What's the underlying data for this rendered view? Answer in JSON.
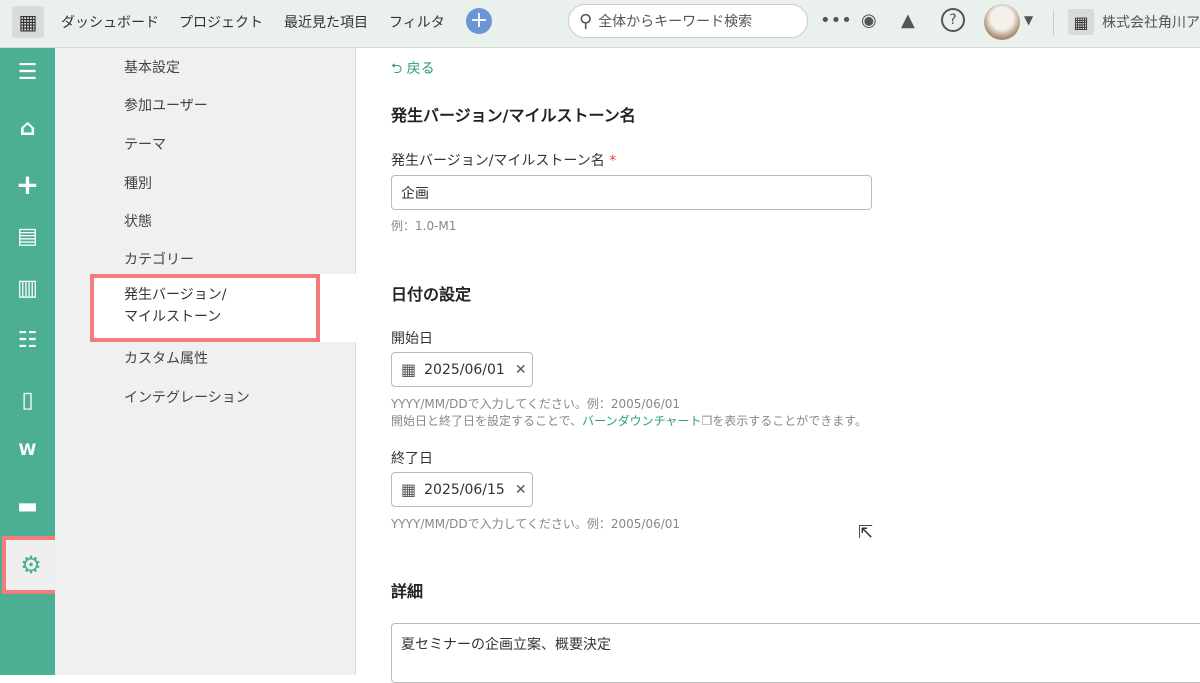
{
  "header": {
    "nav": [
      "ダッシュボード",
      "プロジェクト",
      "最近見た項目",
      "フィルタ"
    ],
    "search_placeholder": "全体からキーワード検索",
    "company": "株式会社角川ア"
  },
  "sidebar": {
    "items": [
      "基本設定",
      "参加ユーザー",
      "テーマ",
      "種別",
      "状態",
      "カテゴリー",
      "発生バージョン/",
      "マイルストーン",
      "カスタム属性",
      "インテグレーション"
    ]
  },
  "main": {
    "back": "戻る",
    "section1": "発生バージョン/マイルストーン名",
    "name_label": "発生バージョン/マイルストーン名",
    "required": "*",
    "name_value": "企画",
    "name_hint": "例：1.0-M1",
    "section2": "日付の設定",
    "start_label": "開始日",
    "start_value": "2025/06/01",
    "date_hint": "YYYY/MM/DDで入力してください。例：2005/06/01",
    "burn_pre": "開始日と終了日を設定することで、",
    "burn_link": "バーンダウンチャート",
    "burn_post": "を表示することができます。",
    "end_label": "終了日",
    "end_value": "2025/06/15",
    "end_hint": "YYYY/MM/DDで入力してください。例：2005/06/01",
    "section3": "詳細",
    "detail_value": "夏セミナーの企画立案、概要決定"
  }
}
